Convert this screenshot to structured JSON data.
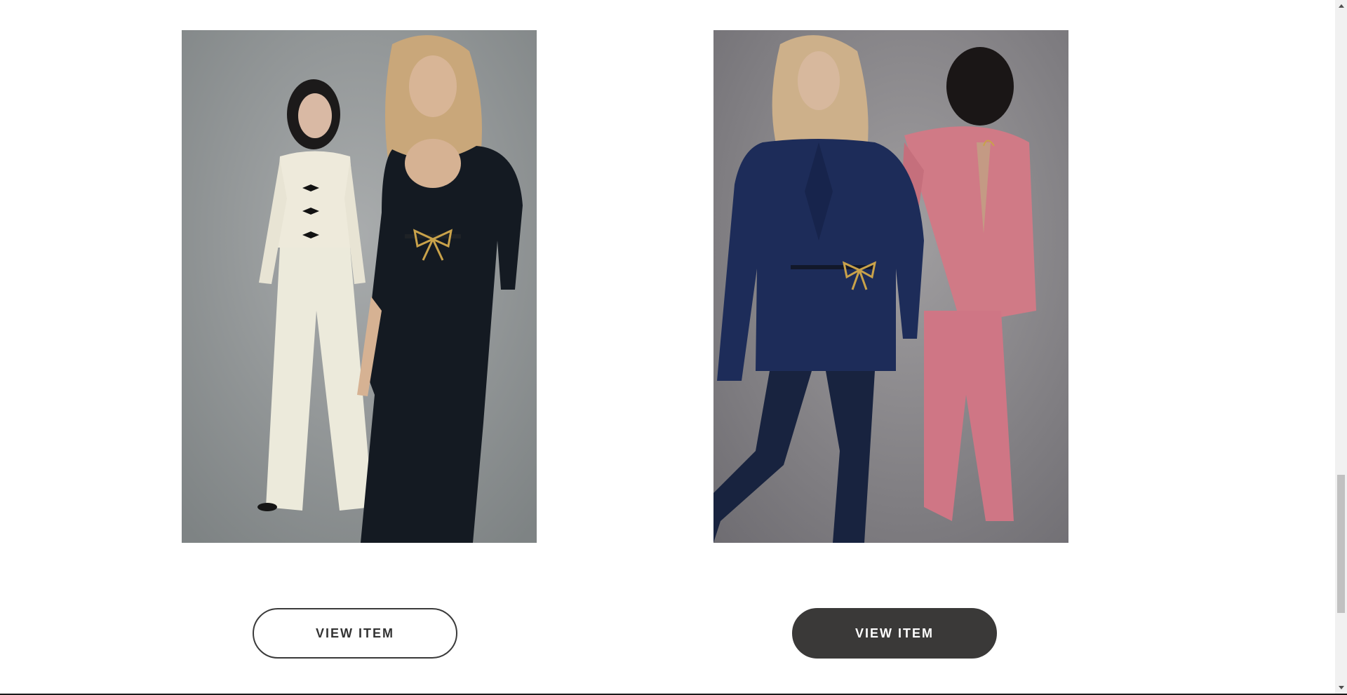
{
  "products": [
    {
      "button_label": "VIEW ITEM",
      "image_alt": "Two models wearing a cream bow-front suit and a black long dress with gold bow belt"
    },
    {
      "button_label": "VIEW ITEM",
      "image_alt": "Two models walking wearing a navy blazer dress with gold bow belt and a pink open-back suit"
    }
  ],
  "colors": {
    "button_dark": "#3a3938",
    "button_border": "#3a3a3a",
    "background": "#ffffff"
  },
  "icons": {
    "scroll_up": "scroll-up-arrow-icon",
    "scroll_down": "scroll-down-arrow-icon"
  }
}
